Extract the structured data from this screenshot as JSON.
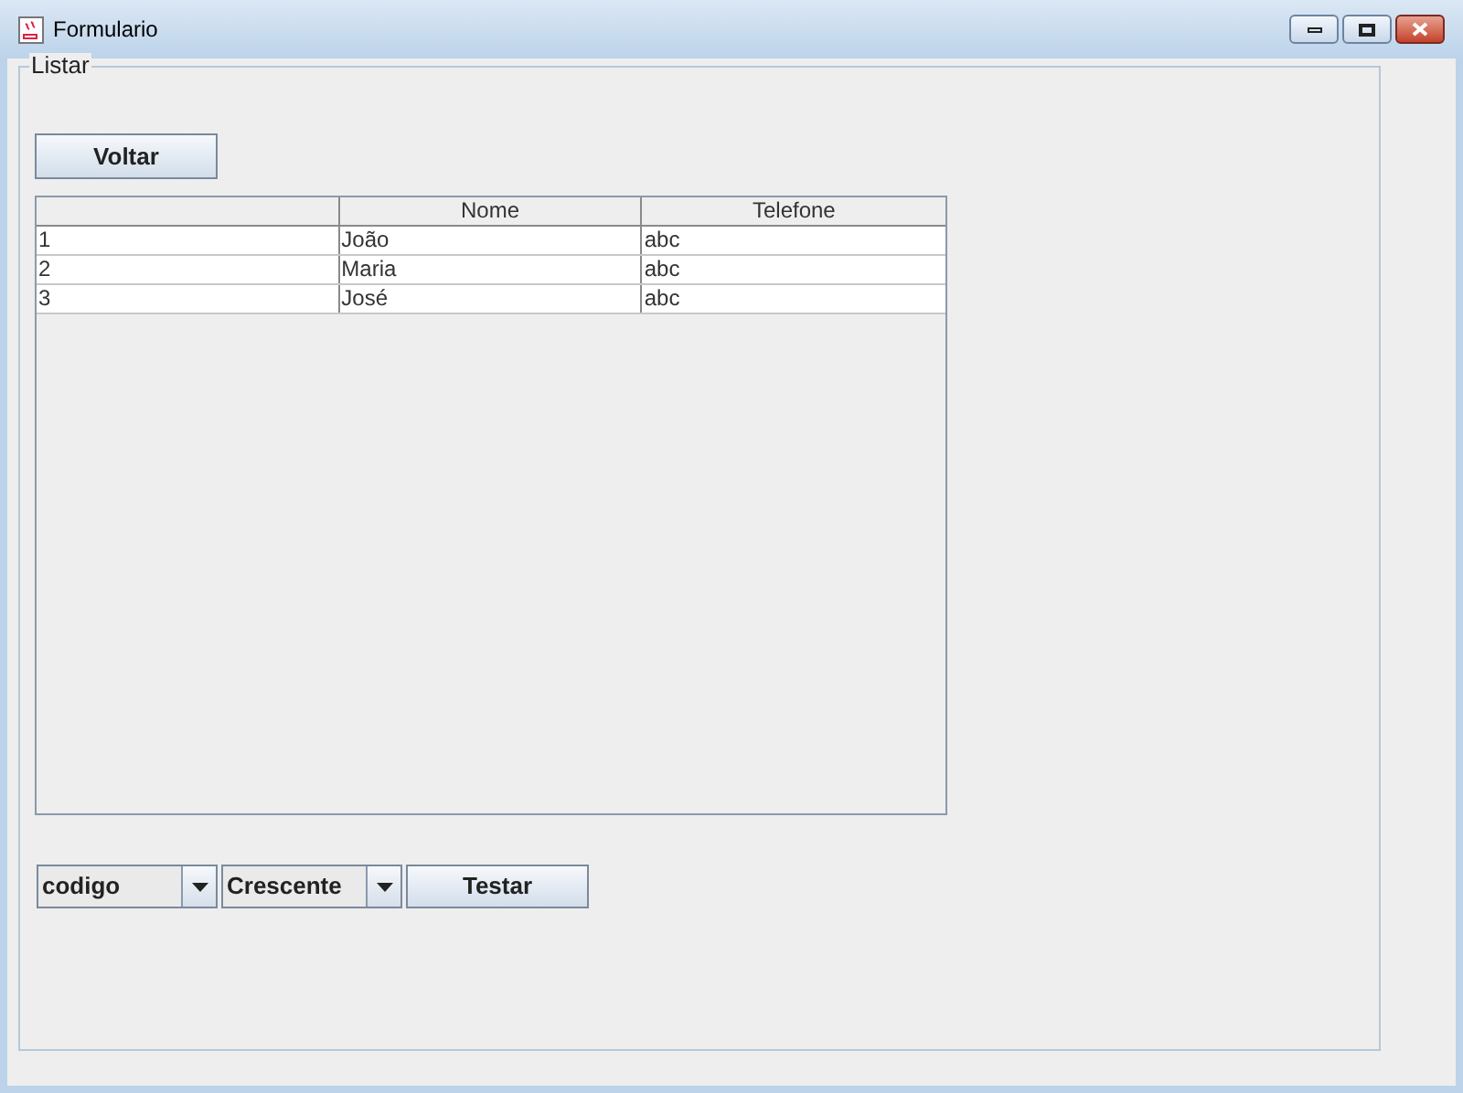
{
  "window": {
    "title": "Formulario"
  },
  "panel": {
    "title": "Listar"
  },
  "back_button": "Voltar",
  "table": {
    "columns": [
      "Nome",
      "Telefone"
    ],
    "rows": [
      [
        "1",
        "João",
        "abc"
      ],
      [
        "2",
        "Maria",
        "abc"
      ],
      [
        "3",
        "José",
        "abc"
      ]
    ]
  },
  "sort_field": {
    "value": "codigo"
  },
  "sort_order": {
    "value": "Crescente"
  },
  "test_button": "Testar"
}
